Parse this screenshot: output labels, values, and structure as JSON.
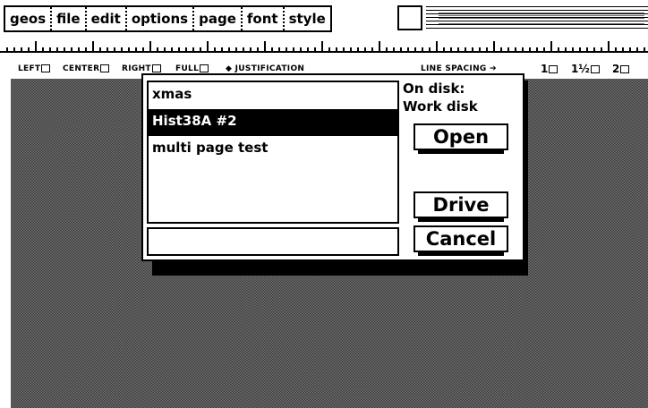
{
  "menu": {
    "items": [
      "geos",
      "file",
      "edit",
      "options",
      "page",
      "font",
      "style"
    ]
  },
  "options_bar": {
    "left": "LEFT",
    "center": "CENTER",
    "right": "RIGHT",
    "full": "FULL",
    "justification": "JUSTIFICATION",
    "line_spacing": "LINE SPACING",
    "spacing_1": "1",
    "spacing_1_5": "1½",
    "spacing_2": "2"
  },
  "dialog": {
    "files": [
      {
        "name": "xmas",
        "selected": false
      },
      {
        "name": "Hist38A #2",
        "selected": true
      },
      {
        "name": "multi page test",
        "selected": false
      }
    ],
    "filename_value": "",
    "on_disk_label": "On disk:",
    "disk_name": "Work disk",
    "open_label": "Open",
    "drive_label": "Drive",
    "cancel_label": "Cancel"
  }
}
